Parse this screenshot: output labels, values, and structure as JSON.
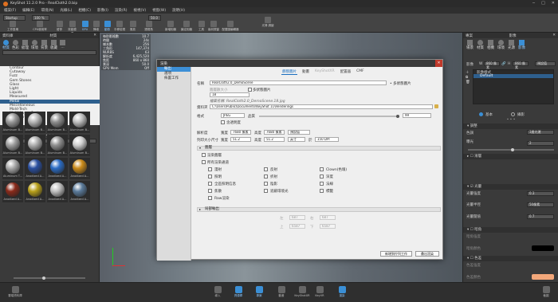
{
  "app": {
    "title": "KeyShot 11.2.0 Pro - RealCloth2.0.bip"
  },
  "menu": [
    "檔案(F)",
    "編輯(E)",
    "環境(N)",
    "光線(L)",
    "相機(C)",
    "影像(I)",
    "渲染(R)",
    "檢視(V)",
    "視窗(W)",
    "說明(H)"
  ],
  "toolbar": {
    "workspace": "Startup",
    "zoom": "100 %",
    "frame": "50.0",
    "buttons": [
      "工作區塊",
      "CPU使用率",
      "暫停",
      "效能模式",
      "GPU",
      "降噪",
      "動態",
      "平移檢視",
      "撥放",
      "透視角",
      "新增相機",
      "鎖定相機",
      "工具",
      "幾何視窗",
      "配置圖編輯器",
      "光滑\n調變"
    ]
  },
  "left": {
    "header": "資料庫",
    "lib_title": "材質",
    "lib_tabs": [
      "材質",
      "色彩",
      "紋理",
      "環境",
      "背景",
      "收藏",
      "..."
    ],
    "categories": [
      "Contour",
      "Cutaway",
      "Fuzz",
      "Gem Stones",
      "Glass",
      "Light",
      "Liquids",
      "Measured",
      "Metal",
      "Miscellaneous",
      "Mold-Tech",
      "Multi-Layer Optics",
      "Packaging"
    ],
    "selected_category": "Metal",
    "thumbs": [
      "Aluminum B...",
      "Aluminum B...",
      "Aluminum B...",
      "Aluminum B...",
      "Aluminum B...",
      "Aluminum B...",
      "Aluminum B...",
      "Aluminum B...",
      "Aluminum T...",
      "Anodized A...",
      "Anodized A...",
      "Anodized A...",
      "Anodized A...",
      "Anodized A...",
      "Anodized A...",
      "Anodized A..."
    ],
    "bottom_button": "雲端資料庫"
  },
  "hud": {
    "labels": [
      "每秒影格數",
      "時間",
      "樣本數",
      "三角形",
      "NURBS",
      "解析度",
      "焦距",
      "景深",
      "GPU Mem"
    ],
    "values": [
      "10.7",
      "24s",
      "256",
      "147,374",
      "63",
      "6,425,520",
      "860 x 860",
      "50.0",
      "Off",
      "1.1GB / 4.0GB"
    ]
  },
  "dialog": {
    "title": "渲染",
    "close": "✕",
    "nav": [
      "輸出",
      "選項",
      "佈置工作"
    ],
    "tabs": [
      "靜態圖片",
      "動畫",
      "KeyShotXR",
      "配置器",
      "CMF"
    ],
    "name_label": "名稱",
    "name_value": "RealCloth2.0_DemoScene",
    "name_suffix": "• 多狀態圖片",
    "layer_label": "圖層數大小",
    "pass_label": "多狀態圖片",
    "pass_value": "18",
    "format_hint": "檔案名稱: RealCloth2.0_DemoScene.18.jpg",
    "folder_label": "資料夾",
    "folder_value": "C:\\Users\\Public\\Documents\\KeyShot 11\\Renderings",
    "format_label": "格式",
    "format_value": "JPEG",
    "quality_label": "品質",
    "quality_value": "99",
    "alpha_label": "含透明度",
    "res_label": "解析度",
    "w_label": "寬度",
    "w_value": "7680 像素",
    "h_label": "高度",
    "h_value": "7680 像素",
    "preset": "預設值",
    "print_label": "列印大小尺寸",
    "pw_value": "51.2",
    "ph_value": "51.2",
    "unit": "英寸",
    "dpi_label": "於",
    "dpi_value": "150 DPI",
    "layers_section": "圖層",
    "render_layers": "渲染圖層",
    "all_passes": "所有渲染通道",
    "passes": [
      "漫射",
      "反射",
      "Clown(色塊)",
      "照明",
      "折射",
      "深度",
      "全區照明信息",
      "陰影",
      "法線",
      "焦散",
      "遮蔽環境光",
      "標籤",
      "Raw渲染"
    ],
    "region_section": "局部輸出",
    "region_labels": [
      "左",
      "右",
      "上",
      "下"
    ],
    "region_values": [
      "687",
      "687",
      "6587",
      "6587"
    ],
    "btn_queue": "新增到佇列工作",
    "btn_render": "彙出渲染"
  },
  "right": {
    "header": "專案",
    "tabs": [
      "場景",
      "材質",
      "相機",
      "環境",
      "光源",
      "影像"
    ],
    "img_label": "影像",
    "w": "860 像素",
    "h": "860 像素",
    "preset": "預設值",
    "list_title": "影像樣式",
    "list_item": "Default",
    "mode_basic": "基本",
    "mode_photo": "攝影",
    "adjust": "調整",
    "sections": [
      "色調",
      "漸層",
      "光暈",
      "暗角",
      "色差"
    ],
    "tone_label": "色調",
    "tone_value": "3層光運",
    "exp_label": "曝光",
    "exp_value": "2",
    "bloom_a_label": "光暈強度",
    "bloom_a_value": "0.3",
    "bloom_r_label": "光暈半徑",
    "bloom_r_value": "50像素",
    "bloom_t_label": "光暈閾值",
    "bloom_t_value": "0.7",
    "vig_label": "暗角強度",
    "vig_color_label": "暗角顏色",
    "chrom_label": "色差強度",
    "chrom_color_label": "色差顏色",
    "accent": "#3a8fd6",
    "vig_color": "#000000",
    "chrom_color": "#f2a77a"
  },
  "bottom": {
    "buttons": [
      "導入",
      "資源庫",
      "專案",
      "動畫",
      "KeyShotXR",
      "KeyVR",
      "渲染"
    ],
    "right": "截圖"
  }
}
